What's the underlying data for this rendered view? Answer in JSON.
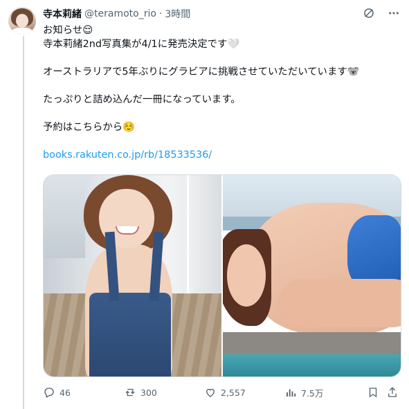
{
  "post": {
    "author_name": "寺本莉緒",
    "author_handle": "@teramoto_rio",
    "separator": "·",
    "timestamp": "3時間",
    "lines": [
      "お知らせ😌",
      "寺本莉緒2nd写真集が4/1に発売決定です🤍",
      "",
      "オーストラリアで5年ぶりにグラビアに挑戦させていただいています🐨",
      "",
      "たっぷりと詰め込んだ一冊になっています。",
      "",
      "予約はこちらから☺️",
      ""
    ],
    "link": "books.rakuten.co.jp/rb/18533536/"
  },
  "media": {
    "photos": [
      {
        "alt": "photo-1"
      },
      {
        "alt": "photo-2"
      }
    ]
  },
  "actions": {
    "replies": "46",
    "reposts": "300",
    "likes": "2,557",
    "views": "7.5万"
  },
  "icons": {
    "grok": "grok-icon",
    "more": "more-icon",
    "reply": "reply-icon",
    "repost": "repost-icon",
    "like": "like-icon",
    "views": "views-icon",
    "bookmark": "bookmark-icon",
    "share": "share-icon"
  },
  "colors": {
    "text": "#0f1419",
    "secondary": "#536471",
    "link": "#1d9bf0",
    "border": "#cfd9de"
  }
}
